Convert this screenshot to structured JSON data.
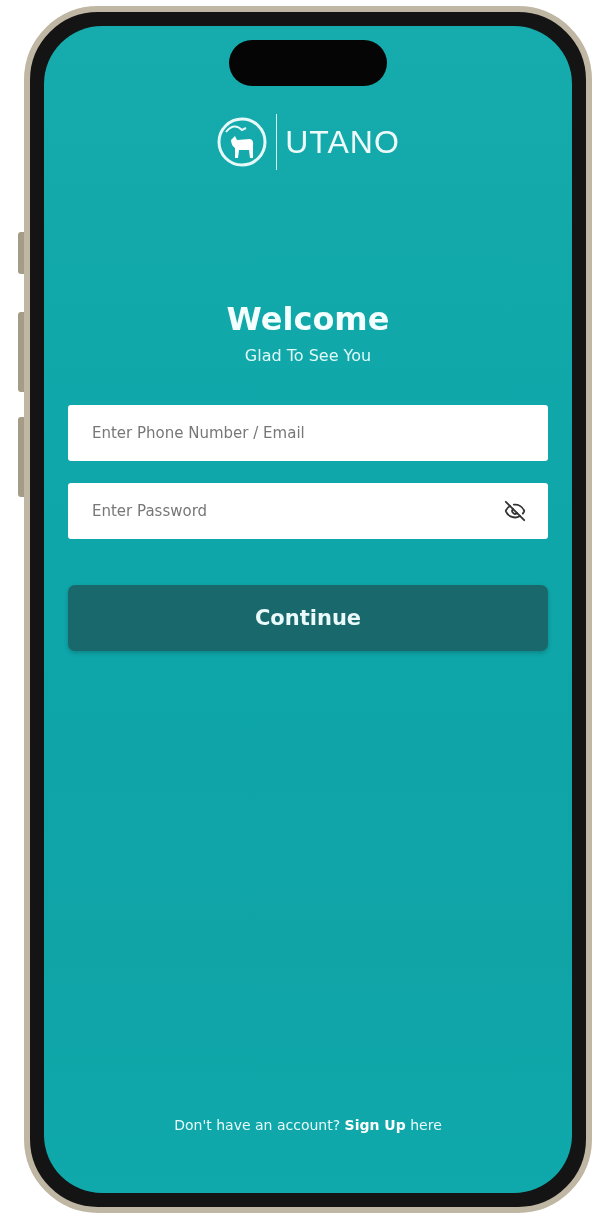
{
  "logo": {
    "name": "UTANO"
  },
  "heading": "Welcome",
  "subheading": "Glad To See You",
  "fields": [
    {
      "kind": "text",
      "placeholder": "Enter Phone Number / Email"
    },
    {
      "kind": "password",
      "placeholder": "Enter Password",
      "password_visible": false
    }
  ],
  "continue_button": "Continue",
  "footer": {
    "prompt": "Don't have an account?",
    "link": "Sign Up",
    "suffix": "here"
  }
}
